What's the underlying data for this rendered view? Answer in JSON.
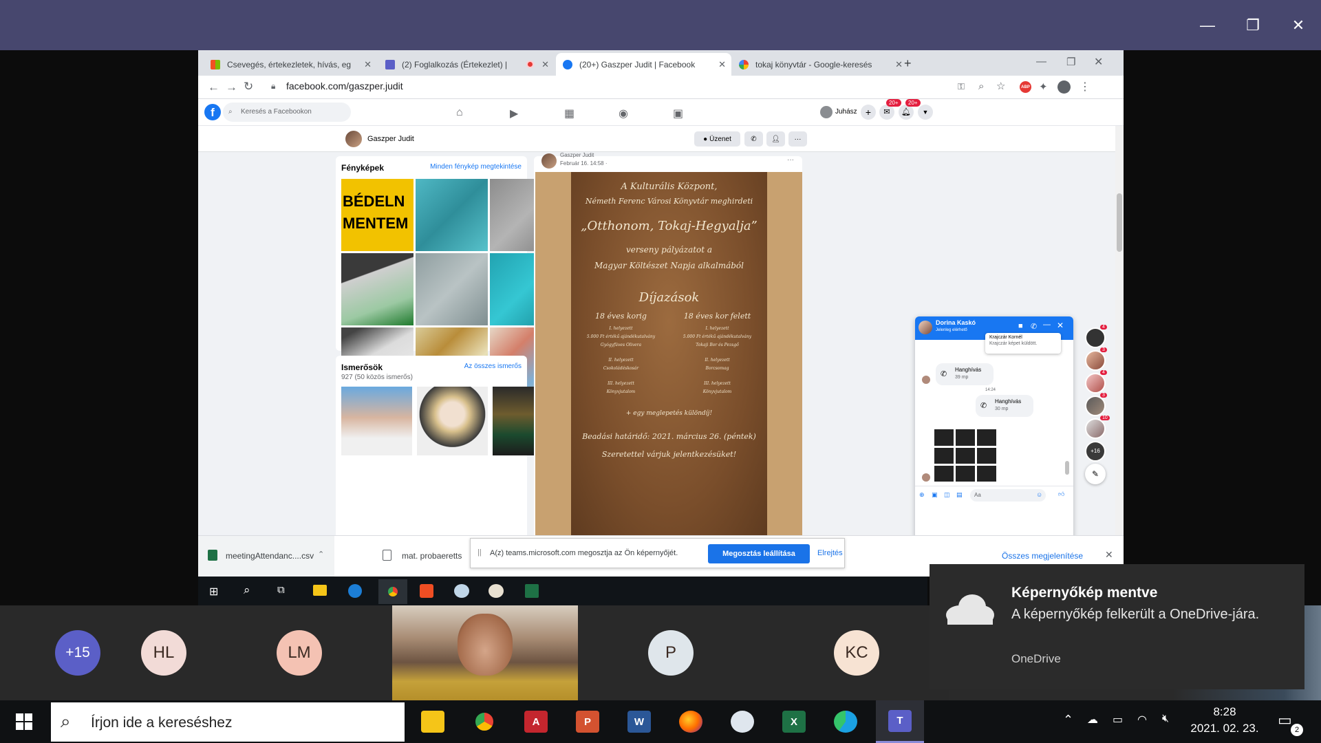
{
  "teams": {
    "window_controls": [
      "minimize-icon",
      "restore-icon",
      "close-icon"
    ]
  },
  "chrome": {
    "tabs": [
      {
        "title": "Csevegés, értekezletek, hívás, eg",
        "fav": "#f25022",
        "icon": "microsoft-icon"
      },
      {
        "title": "(2) Foglalkozás (Értekezlet) |",
        "fav": "#5b5fc7",
        "icon": "teams-icon"
      },
      {
        "title": "(20+) Gaszper Judit | Facebook",
        "fav": "#1877f2",
        "icon": "facebook-icon"
      },
      {
        "title": "tokaj könyvtár - Google-keresés",
        "fav": "#4285f4",
        "icon": "google-icon"
      }
    ],
    "new_tab": "+",
    "url": "facebook.com/gaszper.judit",
    "badge_abp": "ABP"
  },
  "facebook": {
    "search_placeholder": "Keresés a Facebookon",
    "user_short": "Juhász",
    "badge1": "20+",
    "badge2": "20+",
    "profile_name": "Gaszper Judit",
    "message_button": "Üzenet",
    "photos_title": "Fényképek",
    "photos_link": "Minden fénykép megtekintése",
    "friends_title": "Ismerősök",
    "friends_count": "927 (50 közös ismerős)",
    "friends_link": "Az összes ismerős",
    "post_author": "Gaszper Judit",
    "post_date": "Február 16. 14:58 · ",
    "poster": {
      "line1": "A Kulturális Központ,",
      "line2": "Németh Ferenc Városi Könyvtár meghirdeti",
      "title": "„Otthonom, Tokaj-Hegyalja”",
      "line3": "verseny pályázatot a",
      "line4": "Magyar Költészet Napja alkalmából",
      "heading": "Díjazások",
      "col1_head": "18 éves korig",
      "col2_head": "18 éves kor felett",
      "col1": [
        "I. helyezett",
        "5.000 Ft értékű ajándékutalvány",
        "Gyógyfüves Olivera",
        "II. helyezett",
        "Csokoládéskosár",
        "III. helyezett",
        "Könyvjutalom"
      ],
      "col2": [
        "I. helyezett",
        "5.000 Ft értékű ajándékutalvány",
        "Tokaji Bor és Pezsgő",
        "II. helyezett",
        "Borcsomag",
        "III. helyezett",
        "Könyvjutalom"
      ],
      "extra": "+ egy meglepetés különdíj!",
      "deadline": "Beadási határidő: 2021. március 26. (péntek)",
      "closing": "Szeretettel várjuk jelentkezésüket!"
    }
  },
  "chat": {
    "name": "Dorina Kaskó",
    "status": "Jelenleg elérhető",
    "popup_name": "Krajczár Kornél",
    "popup_text": "Krajczár képet küldött.",
    "call1_title": "Hanghívás",
    "call1_dur": "39 mp",
    "time": "14:24",
    "call2_title": "Hanghívás",
    "call2_dur": "30 mp",
    "input_placeholder": "Aa",
    "side_badges": [
      "4",
      "3",
      "4",
      "3",
      "10"
    ],
    "more": "+16"
  },
  "downloads": {
    "file1": "meetingAttendanc....csv",
    "file2": "mat. probaeretts",
    "show_all": "Összes megjelenítése",
    "sharing_text": "A(z) teams.microsoft.com megosztja az Ön képernyőjét.",
    "stop_share": "Megosztás leállítása",
    "hide": "Elrejtés"
  },
  "gallery": {
    "overflow": "+15",
    "participants": [
      "HL",
      "LM",
      "P",
      "KC"
    ]
  },
  "toast": {
    "title": "Képernyőkép mentve",
    "body": "A képernyőkép felkerült a OneDrive-jára.",
    "source": "OneDrive"
  },
  "taskbar": {
    "search_placeholder": "Írjon ide a kereséshez",
    "time": "8:28",
    "date": "2021. 02. 23.",
    "notif_count": "2"
  },
  "colors": {
    "teams_purple": "#47476e",
    "fb_blue": "#1877f2",
    "poster_brown": "#8a5a32"
  }
}
